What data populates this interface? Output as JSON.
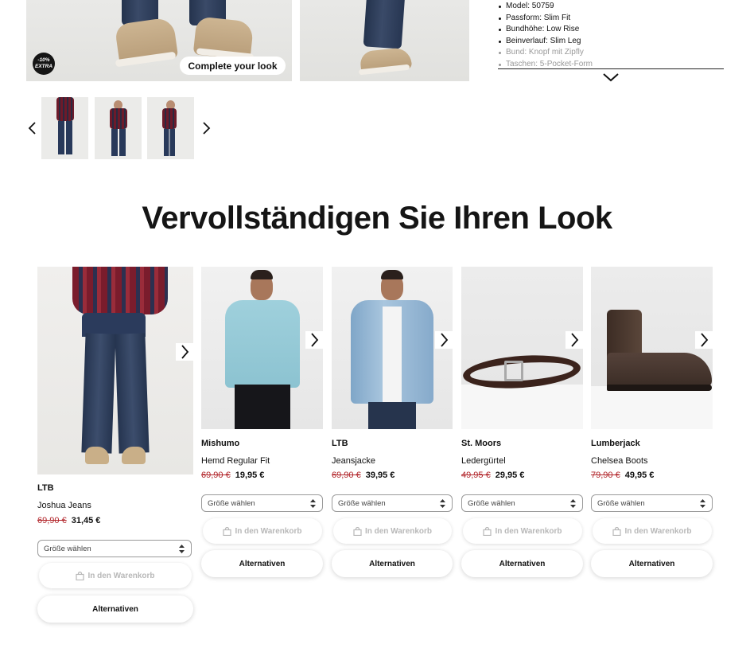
{
  "hero": {
    "badge_line1": "-10%",
    "badge_line2": "EXTRA",
    "complete_look_label": "Complete your look"
  },
  "specs": [
    "Model: 50759",
    "Passform: Slim Fit",
    "Bundhöhe: Low Rise",
    "Beinverlauf: Slim Leg",
    "Bund: Knopf mit Zipfly",
    "Taschen: 5-Pocket-Form"
  ],
  "section_title": "Vervollständigen Sie Ihren Look",
  "products": [
    {
      "brand": "LTB",
      "name": "Joshua Jeans",
      "old_price": "69,90 €",
      "price": "31,45 €",
      "size_placeholder": "Größe wählen",
      "cart_label": "In den Warenkorb",
      "alt_label": "Alternativen"
    },
    {
      "brand": "Mishumo",
      "name": "Hemd Regular Fit",
      "old_price": "69,90 €",
      "price": "19,95 €",
      "size_placeholder": "Größe wählen",
      "cart_label": "In den Warenkorb",
      "alt_label": "Alternativen"
    },
    {
      "brand": "LTB",
      "name": "Jeansjacke",
      "old_price": "69,90 €",
      "price": "39,95 €",
      "size_placeholder": "Größe wählen",
      "cart_label": "In den Warenkorb",
      "alt_label": "Alternativen"
    },
    {
      "brand": "St. Moors",
      "name": "Ledergürtel",
      "old_price": "49,95 €",
      "price": "29,95 €",
      "size_placeholder": "Größe wählen",
      "cart_label": "In den Warenkorb",
      "alt_label": "Alternativen"
    },
    {
      "brand": "Lumberjack",
      "name": "Chelsea Boots",
      "old_price": "79,90 €",
      "price": "49,95 €",
      "size_placeholder": "Größe wählen",
      "cart_label": "In den Warenkorb",
      "alt_label": "Alternativen"
    }
  ],
  "colors": {
    "sale_red": "#b2262b",
    "text": "#111111",
    "disabled": "#b8b8b8"
  },
  "icons": [
    "chevron-left-icon",
    "chevron-right-icon",
    "chevron-down-icon",
    "shopping-bag-icon",
    "sort-updown-icon"
  ]
}
